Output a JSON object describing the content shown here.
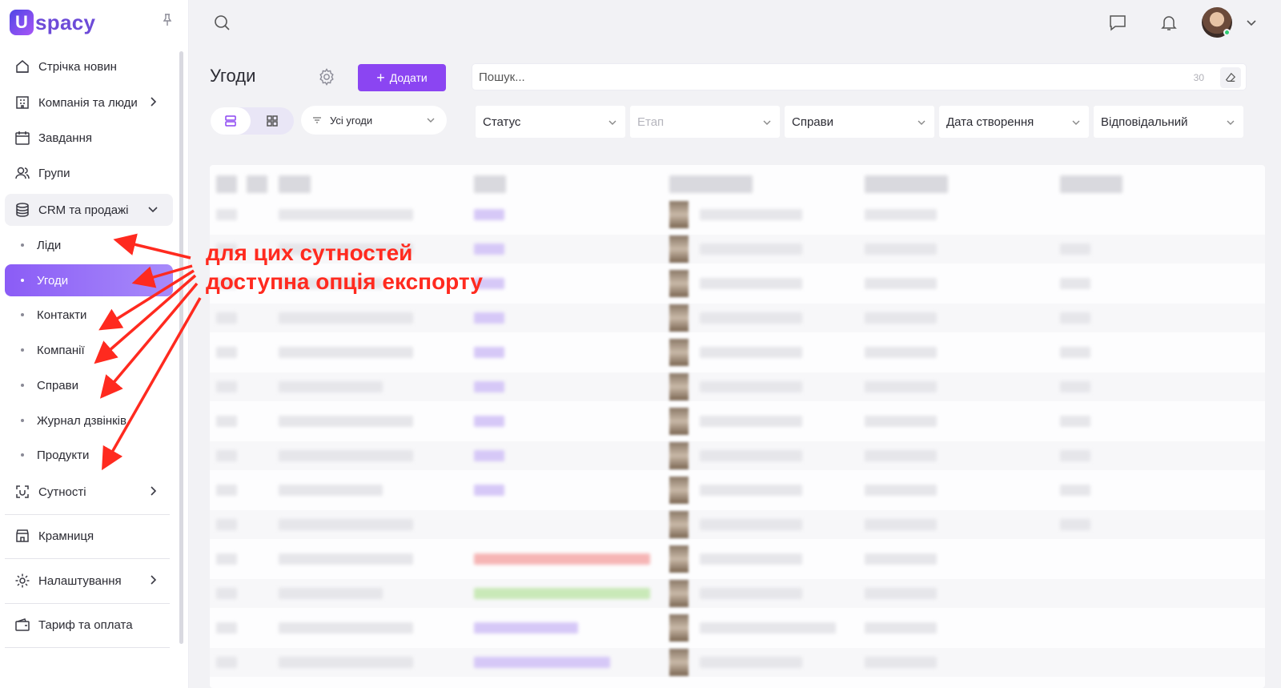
{
  "app": {
    "logo_letter": "U",
    "logo_text": "spacy"
  },
  "sidebar": {
    "items": [
      {
        "label": "Стрічка новин",
        "icon": "home-icon"
      },
      {
        "label": "Компанія та люди",
        "icon": "building-icon"
      },
      {
        "label": "Завдання",
        "icon": "calendar-icon"
      },
      {
        "label": "Групи",
        "icon": "users-icon"
      },
      {
        "label": "CRM та продажі",
        "icon": "database-icon"
      }
    ],
    "crm_sub": [
      {
        "label": "Ліди"
      },
      {
        "label": "Угоди"
      },
      {
        "label": "Контакти"
      },
      {
        "label": "Компанії"
      },
      {
        "label": "Справи"
      },
      {
        "label": "Журнал дзвінків"
      },
      {
        "label": "Продукти"
      }
    ],
    "items_after": [
      {
        "label": "Сутності",
        "icon": "entity-icon"
      },
      {
        "label": "Крамниця",
        "icon": "store-icon"
      },
      {
        "label": "Налаштування",
        "icon": "gear-icon"
      },
      {
        "label": "Тариф та оплата",
        "icon": "wallet-icon"
      }
    ]
  },
  "header": {
    "title": "Угоди",
    "add_label": "Додати",
    "search_placeholder": "Пошук...",
    "search_count": "30"
  },
  "filters": {
    "pipeline": "Усі угоди",
    "selects": [
      "Статус",
      "Етап",
      "Справи",
      "Дата створення",
      "Відповідальний"
    ]
  },
  "annotation": {
    "line1": "для цих сутностей",
    "line2": "доступна опція експорту"
  },
  "colors": {
    "accent": "#8b45f2",
    "annotation": "#ff2a1f"
  }
}
